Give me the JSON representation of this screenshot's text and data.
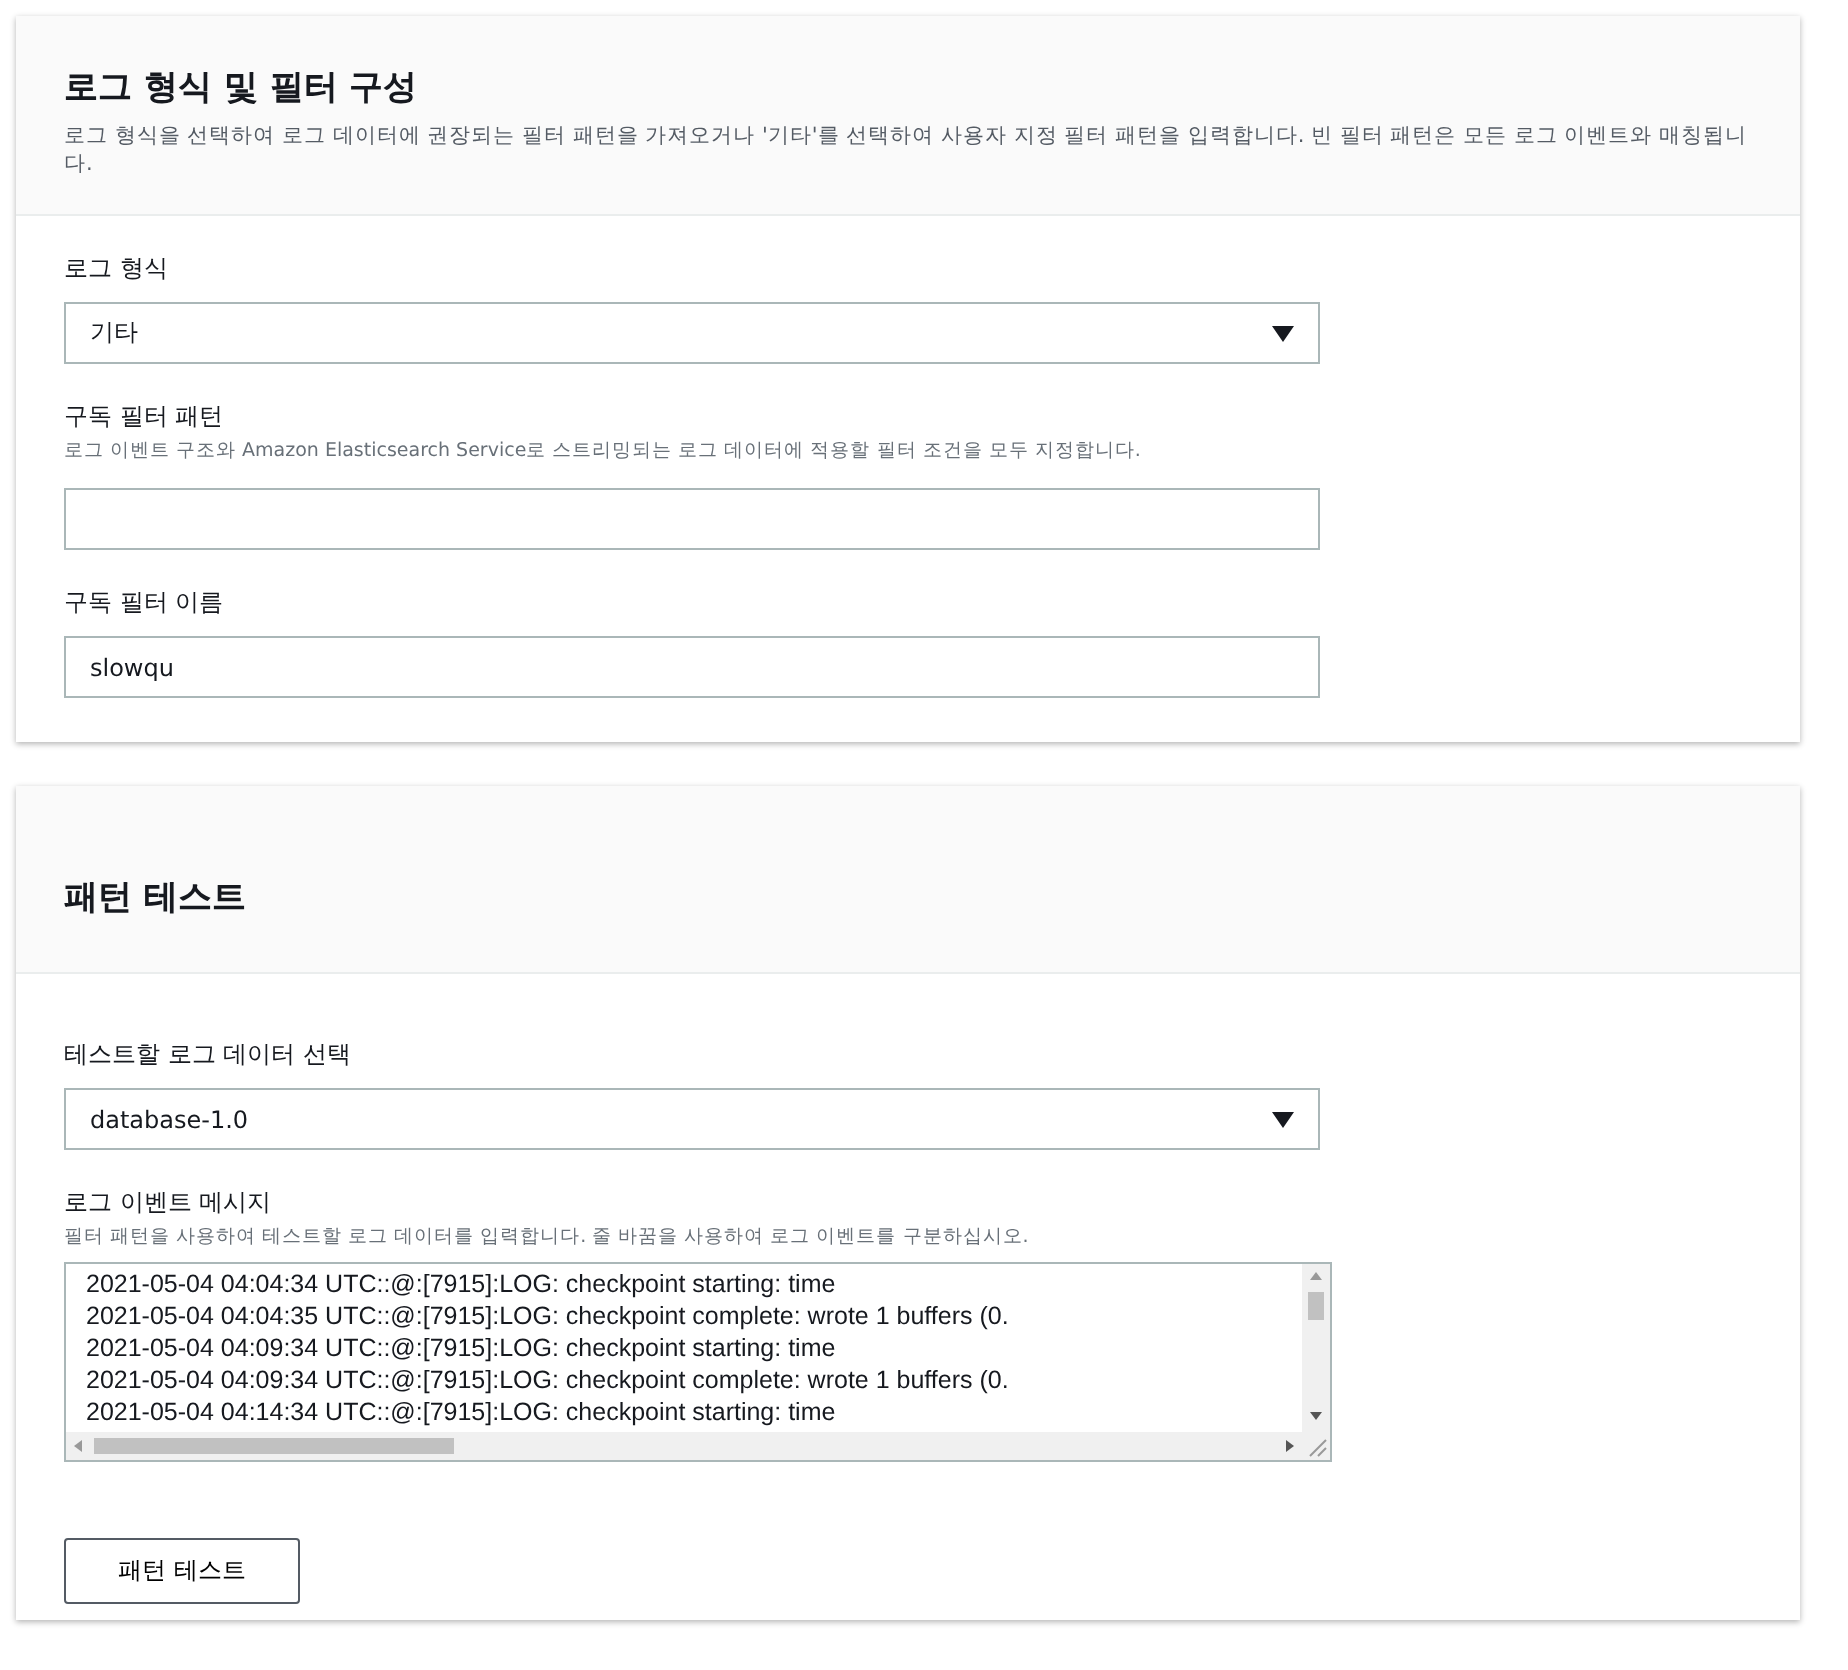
{
  "config_panel": {
    "title": "로그 형식 및 필터 구성",
    "description": "로그 형식을 선택하여 로그 데이터에 권장되는 필터 패턴을 가져오거나 '기타'를 선택하여 사용자 지정 필터 패턴을 입력합니다. 빈 필터 패턴은 모든 로그 이벤트와 매칭됩니다.",
    "fields": [
      {
        "kind": "select",
        "label": "로그 형식",
        "value": "기타"
      },
      {
        "kind": "input",
        "label": "구독 필터 패턴",
        "help": "로그 이벤트 구조와 Amazon Elasticsearch Service로 스트리밍되는 로그 데이터에 적용할 필터 조건을 모두 지정합니다."
      },
      {
        "kind": "input",
        "label": "구독 필터 이름",
        "value": "slowqu"
      }
    ]
  },
  "test_panel": {
    "title": "패턴 테스트",
    "fields": [
      {
        "kind": "select",
        "label": "테스트할 로그 데이터 선택",
        "value": "database-1.0"
      },
      {
        "kind": "textarea",
        "label": "로그 이벤트 메시지",
        "help": "필터 패턴을 사용하여 테스트할 로그 데이터를 입력합니다. 줄 바꿈을 사용하여 로그 이벤트를 구분하십시오.",
        "lines": [
          "2021-05-04 04:04:34 UTC::@:[7915]:LOG:  checkpoint starting: time",
          "2021-05-04 04:04:35 UTC::@:[7915]:LOG:  checkpoint complete: wrote 1 buffers (0.",
          "2021-05-04 04:09:34 UTC::@:[7915]:LOG:  checkpoint starting: time",
          "2021-05-04 04:09:34 UTC::@:[7915]:LOG:  checkpoint complete: wrote 1 buffers (0.",
          "2021-05-04 04:14:34 UTC::@:[7915]:LOG:  checkpoint starting: time"
        ]
      }
    ],
    "button": "패턴 테스트"
  }
}
